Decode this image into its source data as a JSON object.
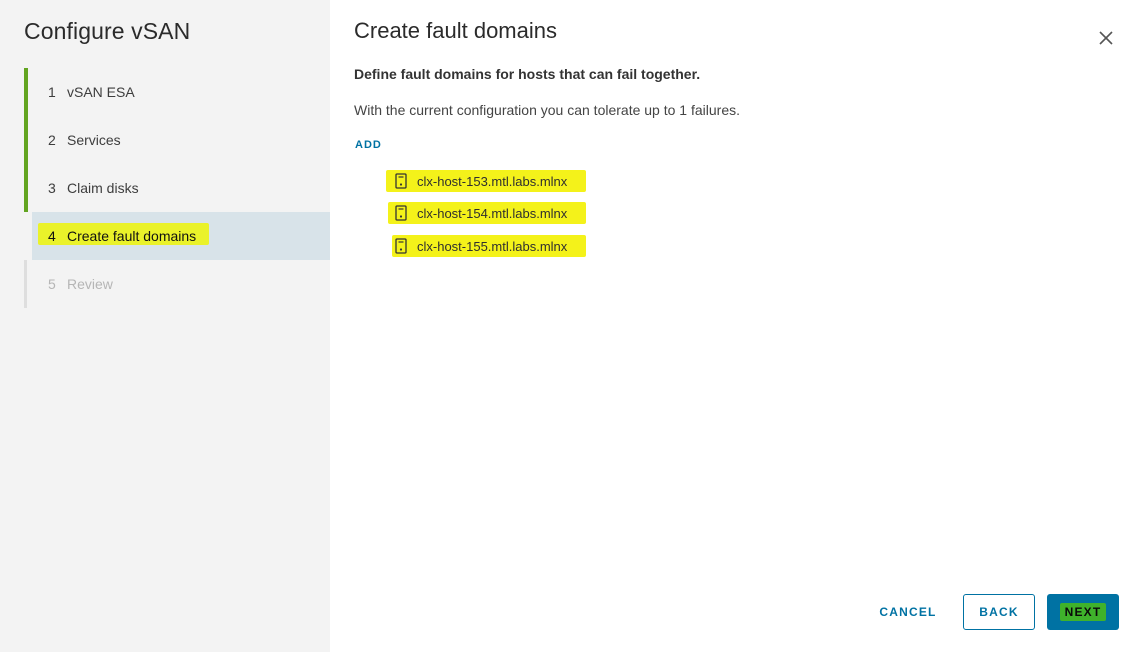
{
  "wizard": {
    "title": "Configure vSAN",
    "steps": [
      {
        "num": "1",
        "label": "vSAN ESA"
      },
      {
        "num": "2",
        "label": "Services"
      },
      {
        "num": "3",
        "label": "Claim disks"
      },
      {
        "num": "4",
        "label": "Create fault domains"
      },
      {
        "num": "5",
        "label": "Review"
      }
    ]
  },
  "main": {
    "title": "Create fault domains",
    "description": "Define fault domains for hosts that can fail together.",
    "tolerance_text": "With the current configuration you can tolerate up to 1 failures.",
    "add_label": "ADD",
    "hosts": [
      {
        "name": "clx-host-153.mtl.labs.mlnx",
        "icon": "server-icon"
      },
      {
        "name": "clx-host-154.mtl.labs.mlnx",
        "icon": "server-icon"
      },
      {
        "name": "clx-host-155.mtl.labs.mlnx",
        "icon": "server-icon"
      }
    ]
  },
  "footer": {
    "cancel_label": "CANCEL",
    "back_label": "BACK",
    "next_label": "NEXT"
  },
  "colors": {
    "accent": "#0072a3",
    "completed_step": "#62a420",
    "highlight": "#f4f21a",
    "current_step_bg": "#d8e3e9"
  }
}
